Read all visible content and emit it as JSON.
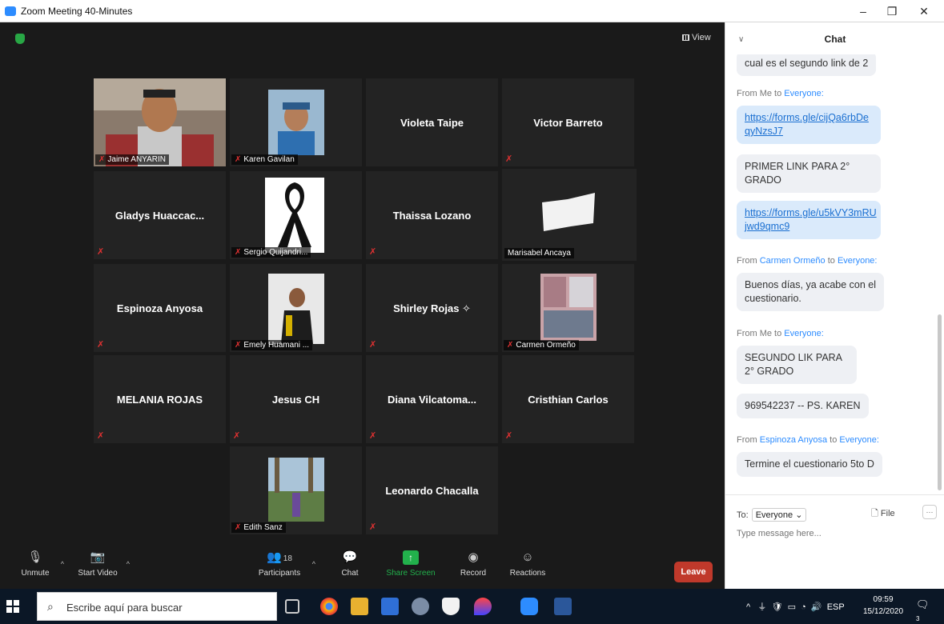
{
  "window": {
    "title": "Zoom Meeting 40-Minutes",
    "min": "–",
    "max": "❐",
    "close": "✕"
  },
  "view_button": "View",
  "tiles": [
    {
      "name": "Jaime ANYARIN",
      "type": "video"
    },
    {
      "name": "Karen Gavilan",
      "type": "video"
    },
    {
      "name": "Violeta Taipe",
      "type": "name"
    },
    {
      "name": "Victor Barreto",
      "type": "name"
    },
    {
      "name": "Gladys Huaccac...",
      "type": "name"
    },
    {
      "name": "Sergio Quijandri...",
      "type": "video"
    },
    {
      "name": "Thaissa Lozano",
      "type": "name"
    },
    {
      "name": "Marisabel Ancaya",
      "type": "video"
    },
    {
      "name": "Espinoza Anyosa",
      "type": "name"
    },
    {
      "name": "Emely Huamani ...",
      "type": "video"
    },
    {
      "name": "Shirley Rojas ✧",
      "type": "name"
    },
    {
      "name": "Carmen Ormeño",
      "type": "video"
    },
    {
      "name": "MELANIA ROJAS",
      "type": "name"
    },
    {
      "name": "Jesus CH",
      "type": "name"
    },
    {
      "name": "Diana Vilcatoma...",
      "type": "name"
    },
    {
      "name": "Cristhian Carlos",
      "type": "name"
    },
    {
      "name": "Edith Sanz",
      "type": "video"
    },
    {
      "name": "Leonardo Chacalla",
      "type": "name"
    }
  ],
  "toolbar": {
    "unmute": "Unmute",
    "start_video": "Start Video",
    "participants": "Participants",
    "participants_count": "18",
    "chat": "Chat",
    "share_screen": "Share Screen",
    "record": "Record",
    "reactions": "Reactions",
    "leave": "Leave"
  },
  "chat": {
    "title": "Chat",
    "messages": [
      {
        "text": "cual es el segundo link de 2"
      },
      {
        "from": "From Me to ",
        "who": "Everyone:"
      },
      {
        "text": "https://forms.gle/cijQa6rbDe qyNzsJ7",
        "link": true
      },
      {
        "text": "PRIMER LINK PARA 2° GRADO"
      },
      {
        "text": "https://forms.gle/u5kVY3mRU jwd9qmc9",
        "link": true
      },
      {
        "from": "From ",
        "who": "Carmen Ormeño",
        "to": " to ",
        "who2": "Everyone:"
      },
      {
        "text": "Buenos días, ya acabe con el cuestionario."
      },
      {
        "from": "From Me to ",
        "who": "Everyone:"
      },
      {
        "text": "SEGUNDO LIK PARA 2° GRADO"
      },
      {
        "text": "969542237 -- PS. KAREN"
      },
      {
        "from": "From ",
        "who": "Espinoza Anyosa",
        "to": " to ",
        "who2": "Everyone:"
      },
      {
        "text": "Termine el cuestionario 5to D"
      }
    ],
    "to_label": "To:",
    "to_value": "Everyone ⌄",
    "file": "File",
    "placeholder": "Type message here..."
  },
  "taskbar": {
    "search": "Escribe aquí para buscar",
    "lang": "ESP",
    "time": "09:59",
    "date": "15/12/2020",
    "notif_count": "3"
  }
}
